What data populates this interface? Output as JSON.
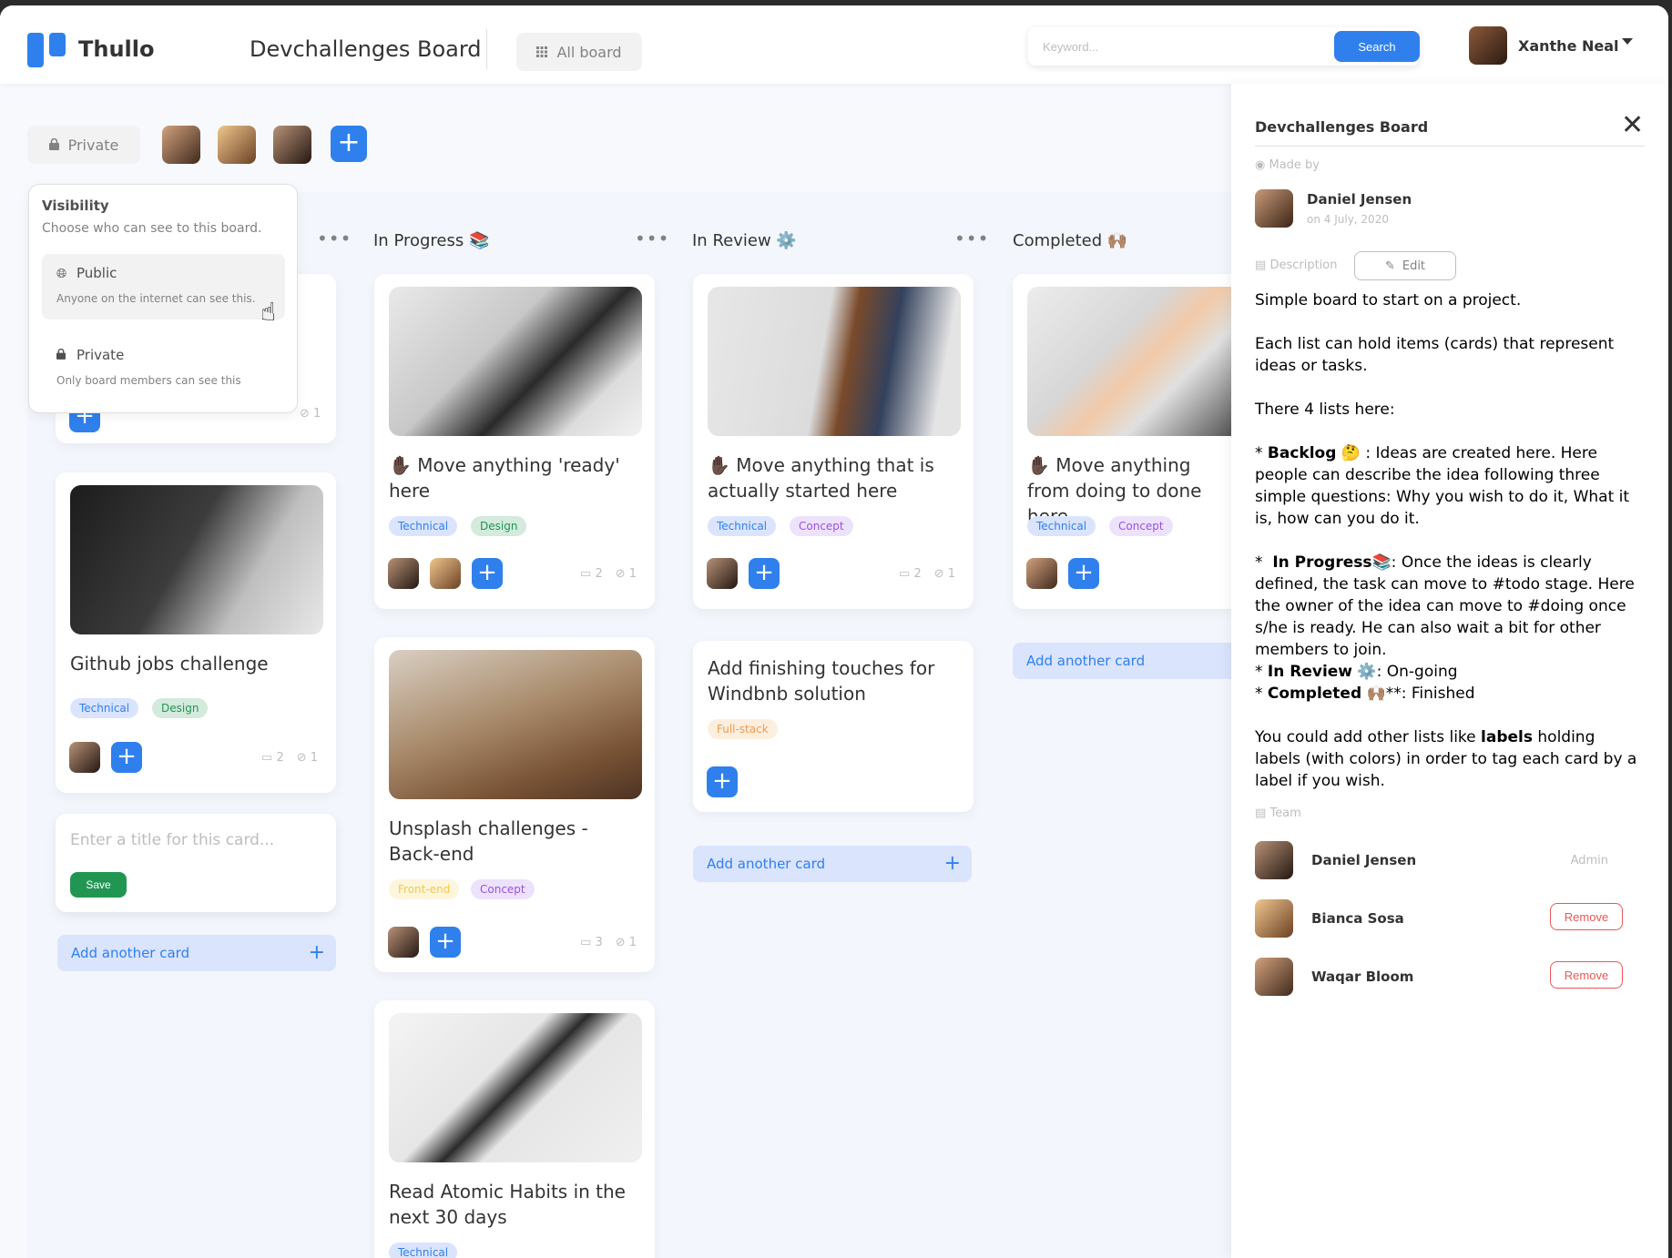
{
  "header": {
    "brand": "Thullo",
    "board_title": "Devchallenges Board",
    "all_board_label": "All board",
    "search_placeholder": "Keyword...",
    "search_label": "Search",
    "user_name": "Xanthe Neal"
  },
  "toolbar": {
    "visibility_label": "Private"
  },
  "popover": {
    "title": "Visibility",
    "subtitle": "Choose who can see to this board.",
    "public_title": "Public",
    "public_desc": "Anyone on the internet can see this.",
    "private_title": "Private",
    "private_desc": "Only board members can see this"
  },
  "lists": {
    "in_progress": "In Progress 📚",
    "in_review": "In Review ⚙️",
    "completed": "Completed 🙌🏽"
  },
  "cards": {
    "github": {
      "title": "Github jobs challenge",
      "tag1": "Technical",
      "tag2": "Design",
      "comments": "2",
      "attachments": "1"
    },
    "backlog_top": {
      "attachments": "1"
    },
    "ip1": {
      "title": "✋🏿 Move anything 'ready' here",
      "tag1": "Technical",
      "tag2": "Design",
      "comments": "2",
      "attachments": "1"
    },
    "ip2": {
      "title": "Unsplash challenges - Back-end",
      "tag1": "Front-end",
      "tag2": "Concept",
      "comments": "3",
      "attachments": "1"
    },
    "ip3": {
      "title": "Read Atomic Habits in the next 30 days",
      "tag1": "Technical"
    },
    "ir1": {
      "title": "✋🏿 Move anything that is actually started here",
      "tag1": "Technical",
      "tag2": "Concept",
      "comments": "2",
      "attachments": "1"
    },
    "ir2": {
      "title": "Add finishing touches for Windbnb solution",
      "tag1": "Full-stack"
    },
    "c1": {
      "title": "✋🏿 Move anything from doing to done here",
      "tag1": "Technical",
      "tag2": "Concept"
    }
  },
  "new_card": {
    "placeholder": "Enter a title for this card...",
    "save_label": "Save"
  },
  "add_another_card": "Add another card",
  "panel": {
    "title": "Devchallenges Board",
    "made_by_label": "Made by",
    "made_by_name": "Daniel Jensen",
    "made_by_date": "on 4 July, 2020",
    "description_label": "Description",
    "edit_label": "Edit",
    "desc_p1": "Simple board to start on a project.",
    "desc_p2": "Each list can hold items (cards) that represent ideas or tasks.",
    "desc_p3": "There 4 lists here:",
    "desc_backlog_bold": "Backlog",
    "desc_backlog_text": "🤔 : Ideas are created here. Here people can describe the idea following three simple questions: Why you wish to do it, What it is, how can you do it.",
    "desc_ip_bold": "In Progress",
    "desc_ip_text": "📚: Once the ideas is clearly defined, the task can move to #todo stage. Here the owner of the idea can move to #doing once s/he is ready. He can also wait a bit for other members to join.",
    "desc_ir_bold": "In Review",
    "desc_ir_text": " ⚙️: On-going",
    "desc_c_bold": "Completed",
    "desc_c_text": " 🙌🏽**: Finished",
    "desc_p5_a": "You could add other lists like ",
    "desc_p5_bold": "labels",
    "desc_p5_b": " holding labels (with colors) in order to tag each card by a label if you wish.",
    "team_label": "Team",
    "team": [
      {
        "name": "Daniel Jensen",
        "role": "Admin"
      },
      {
        "name": "Bianca Sosa",
        "action": "Remove"
      },
      {
        "name": "Waqar Bloom",
        "action": "Remove"
      }
    ]
  },
  "colors": {
    "accent": "#2f80ed",
    "save_green": "#219653",
    "danger": "#eb5757"
  }
}
